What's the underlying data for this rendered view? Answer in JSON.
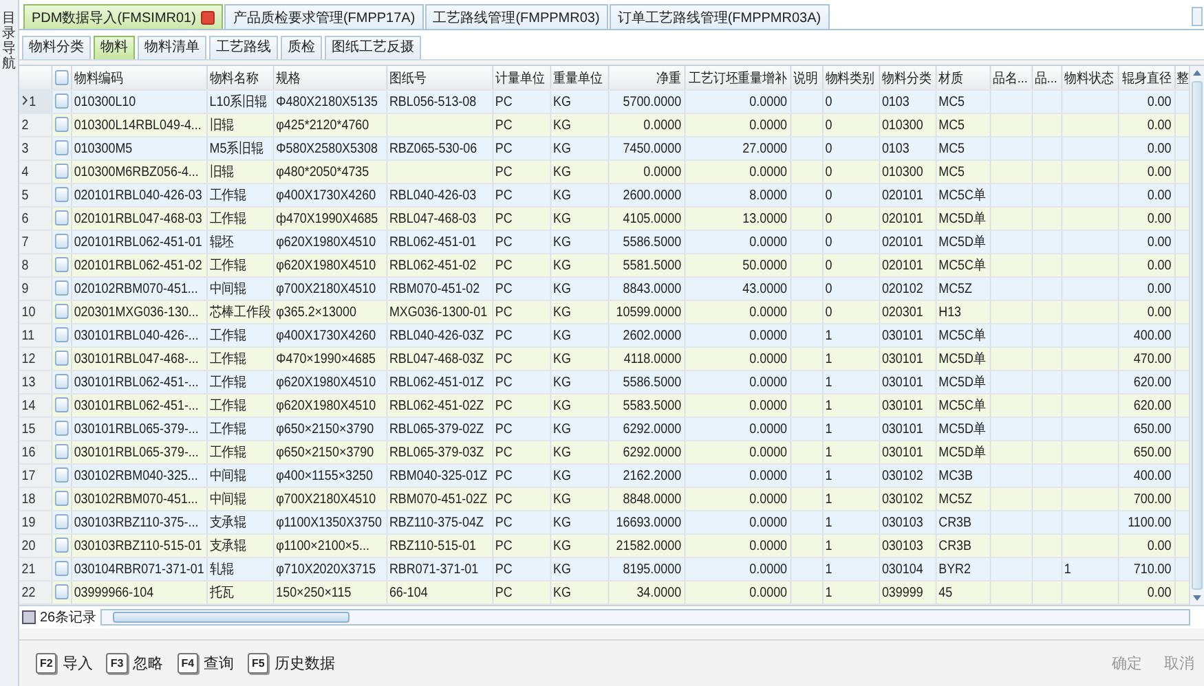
{
  "side_label": "目录导航",
  "tabs": [
    {
      "label": "PDM数据导入(FMSIMR01)",
      "selected": true,
      "closable": true
    },
    {
      "label": "产品质检要求管理(FMPP17A)",
      "selected": false,
      "closable": false
    },
    {
      "label": "工艺路线管理(FMPPMR03)",
      "selected": false,
      "closable": false
    },
    {
      "label": "订单工艺路线管理(FMPPMR03A)",
      "selected": false,
      "closable": false
    }
  ],
  "subtabs": [
    {
      "label": "物料分类",
      "selected": false
    },
    {
      "label": "物料",
      "selected": true
    },
    {
      "label": "物料清单",
      "selected": false
    },
    {
      "label": "工艺路线",
      "selected": false
    },
    {
      "label": "质检",
      "selected": false
    },
    {
      "label": "图纸工艺反摄",
      "selected": false
    }
  ],
  "table": {
    "columns": [
      {
        "label": "物料编码",
        "numeric": false
      },
      {
        "label": "物料名称",
        "numeric": false
      },
      {
        "label": "规格",
        "numeric": false
      },
      {
        "label": "图纸号",
        "numeric": false
      },
      {
        "label": "计量单位",
        "numeric": false
      },
      {
        "label": "重量单位",
        "numeric": false
      },
      {
        "label": "净重",
        "numeric": true
      },
      {
        "label": "工艺订坯重量增补",
        "numeric": true
      },
      {
        "label": "说明",
        "numeric": false
      },
      {
        "label": "物料类别",
        "numeric": false
      },
      {
        "label": "物料分类",
        "numeric": false
      },
      {
        "label": "材质",
        "numeric": false
      },
      {
        "label": "品名...",
        "numeric": false
      },
      {
        "label": "品...",
        "numeric": false
      },
      {
        "label": "物料状态",
        "numeric": false
      },
      {
        "label": "辊身直径",
        "numeric": true
      },
      {
        "label": "整",
        "numeric": false
      }
    ],
    "rows": [
      {
        "num": "1",
        "selected": true,
        "checked": false,
        "cells": [
          "010300L10",
          "L10系旧辊",
          "Φ480X2180X5135",
          "RBL056-513-08",
          "PC",
          "KG",
          "5700.0000",
          "0.0000",
          "",
          "0",
          "0103",
          "MC5",
          "",
          "",
          "",
          "0.00",
          ""
        ]
      },
      {
        "num": "2",
        "selected": false,
        "checked": false,
        "cells": [
          "010300L14RBL049-4...",
          "旧辊",
          "φ425*2120*4760",
          "",
          "PC",
          "KG",
          "0.0000",
          "0.0000",
          "",
          "0",
          "010300",
          "MC5",
          "",
          "",
          "",
          "0.00",
          ""
        ]
      },
      {
        "num": "3",
        "selected": false,
        "checked": false,
        "cells": [
          "010300M5",
          "M5系旧辊",
          "Φ580X2580X5308",
          "RBZ065-530-06",
          "PC",
          "KG",
          "7450.0000",
          "27.0000",
          "",
          "0",
          "0103",
          "MC5",
          "",
          "",
          "",
          "0.00",
          ""
        ]
      },
      {
        "num": "4",
        "selected": false,
        "checked": false,
        "cells": [
          "010300M6RBZ056-4...",
          "旧辊",
          "φ480*2050*4735",
          "",
          "PC",
          "KG",
          "0.0000",
          "0.0000",
          "",
          "0",
          "010300",
          "MC5",
          "",
          "",
          "",
          "0.00",
          ""
        ]
      },
      {
        "num": "5",
        "selected": false,
        "checked": false,
        "cells": [
          "020101RBL040-426-03",
          "工作辊",
          "φ400X1730X4260",
          "RBL040-426-03",
          "PC",
          "KG",
          "2600.0000",
          "8.0000",
          "",
          "0",
          "020101",
          "MC5C单",
          "",
          "",
          "",
          "0.00",
          ""
        ]
      },
      {
        "num": "6",
        "selected": false,
        "checked": false,
        "cells": [
          "020101RBL047-468-03",
          "工作辊",
          "ф470X1990X4685",
          "RBL047-468-03",
          "PC",
          "KG",
          "4105.0000",
          "13.0000",
          "",
          "0",
          "020101",
          "MC5D单",
          "",
          "",
          "",
          "0.00",
          ""
        ]
      },
      {
        "num": "7",
        "selected": false,
        "checked": false,
        "cells": [
          "020101RBL062-451-01",
          "辊坯",
          "φ620X1980X4510",
          "RBL062-451-01",
          "PC",
          "KG",
          "5586.5000",
          "0.0000",
          "",
          "0",
          "020101",
          "MC5D单",
          "",
          "",
          "",
          "0.00",
          ""
        ]
      },
      {
        "num": "8",
        "selected": false,
        "checked": false,
        "cells": [
          "020101RBL062-451-02",
          "工作辊",
          "φ620X1980X4510",
          "RBL062-451-02",
          "PC",
          "KG",
          "5581.5000",
          "50.0000",
          "",
          "0",
          "020101",
          "MC5C单",
          "",
          "",
          "",
          "0.00",
          ""
        ]
      },
      {
        "num": "9",
        "selected": false,
        "checked": false,
        "cells": [
          "020102RBM070-451...",
          "中间辊",
          "φ700X2180X4510",
          "RBM070-451-02",
          "PC",
          "KG",
          "8843.0000",
          "43.0000",
          "",
          "0",
          "020102",
          "MC5Z",
          "",
          "",
          "",
          "0.00",
          ""
        ]
      },
      {
        "num": "10",
        "selected": false,
        "checked": false,
        "cells": [
          "020301MXG036-130...",
          "芯棒工作段",
          "φ365.2×13000",
          "MXG036-1300-01",
          "PC",
          "KG",
          "10599.0000",
          "0.0000",
          "",
          "0",
          "020301",
          "H13",
          "",
          "",
          "",
          "0.00",
          ""
        ]
      },
      {
        "num": "11",
        "selected": false,
        "checked": false,
        "cells": [
          "030101RBL040-426-...",
          "工作辊",
          "φ400X1730X4260",
          "RBL040-426-03Z",
          "PC",
          "KG",
          "2602.0000",
          "0.0000",
          "",
          "1",
          "030101",
          "MC5C单",
          "",
          "",
          "",
          "400.00",
          ""
        ]
      },
      {
        "num": "12",
        "selected": false,
        "checked": false,
        "cells": [
          "030101RBL047-468-...",
          "工作辊",
          "Φ470×1990×4685",
          "RBL047-468-03Z",
          "PC",
          "KG",
          "4118.0000",
          "0.0000",
          "",
          "1",
          "030101",
          "MC5D单",
          "",
          "",
          "",
          "470.00",
          ""
        ]
      },
      {
        "num": "13",
        "selected": false,
        "checked": false,
        "cells": [
          "030101RBL062-451-...",
          "工作辊",
          "φ620X1980X4510",
          "RBL062-451-01Z",
          "PC",
          "KG",
          "5586.5000",
          "0.0000",
          "",
          "1",
          "030101",
          "MC5D单",
          "",
          "",
          "",
          "620.00",
          ""
        ]
      },
      {
        "num": "14",
        "selected": false,
        "checked": false,
        "cells": [
          "030101RBL062-451-...",
          "工作辊",
          "φ620X1980X4510",
          "RBL062-451-02Z",
          "PC",
          "KG",
          "5583.5000",
          "0.0000",
          "",
          "1",
          "030101",
          "MC5C单",
          "",
          "",
          "",
          "620.00",
          ""
        ]
      },
      {
        "num": "15",
        "selected": false,
        "checked": false,
        "cells": [
          "030101RBL065-379-...",
          "工作辊",
          "φ650×2150×3790",
          "RBL065-379-02Z",
          "PC",
          "KG",
          "6292.0000",
          "0.0000",
          "",
          "1",
          "030101",
          "MC5D单",
          "",
          "",
          "",
          "650.00",
          ""
        ]
      },
      {
        "num": "16",
        "selected": false,
        "checked": false,
        "cells": [
          "030101RBL065-379-...",
          "工作辊",
          "φ650×2150×3790",
          "RBL065-379-03Z",
          "PC",
          "KG",
          "6292.0000",
          "0.0000",
          "",
          "1",
          "030101",
          "MC5D单",
          "",
          "",
          "",
          "650.00",
          ""
        ]
      },
      {
        "num": "17",
        "selected": false,
        "checked": false,
        "cells": [
          "030102RBM040-325...",
          "中间辊",
          "φ400×1155×3250",
          "RBM040-325-01Z",
          "PC",
          "KG",
          "2162.2000",
          "0.0000",
          "",
          "1",
          "030102",
          "MC3B",
          "",
          "",
          "",
          "400.00",
          ""
        ]
      },
      {
        "num": "18",
        "selected": false,
        "checked": false,
        "cells": [
          "030102RBM070-451...",
          "中间辊",
          "φ700X2180X4510",
          "RBM070-451-02Z",
          "PC",
          "KG",
          "8848.0000",
          "0.0000",
          "",
          "1",
          "030102",
          "MC5Z",
          "",
          "",
          "",
          "700.00",
          ""
        ]
      },
      {
        "num": "19",
        "selected": false,
        "checked": false,
        "cells": [
          "030103RBZ110-375-...",
          "支承辊",
          "φ1100X1350X3750",
          "RBZ110-375-04Z",
          "PC",
          "KG",
          "16693.0000",
          "0.0000",
          "",
          "1",
          "030103",
          "CR3B",
          "",
          "",
          "",
          "1100.00",
          ""
        ]
      },
      {
        "num": "20",
        "selected": false,
        "checked": false,
        "cells": [
          "030103RBZ110-515-01",
          "支承辊",
          "φ1100×2100×5...",
          "RBZ110-515-01",
          "PC",
          "KG",
          "21582.0000",
          "0.0000",
          "",
          "1",
          "030103",
          "CR3B",
          "",
          "",
          "",
          "0.00",
          ""
        ]
      },
      {
        "num": "21",
        "selected": false,
        "checked": false,
        "cells": [
          "030104RBR071-371-01",
          "轧辊",
          "φ710X2020X3715",
          "RBR071-371-01",
          "PC",
          "KG",
          "8195.0000",
          "0.0000",
          "",
          "1",
          "030104",
          "BYR2",
          "",
          "",
          "1",
          "710.00",
          ""
        ]
      },
      {
        "num": "22",
        "selected": false,
        "checked": false,
        "cells": [
          "03999966-104",
          "托瓦",
          "150×250×115",
          "66-104",
          "PC",
          "KG",
          "34.0000",
          "0.0000",
          "",
          "1",
          "039999",
          "45",
          "",
          "",
          "",
          "0.00",
          ""
        ]
      }
    ],
    "record_count": "26条记录",
    "select_all_checked": false
  },
  "actions": [
    {
      "key": "F2",
      "label": "导入"
    },
    {
      "key": "F3",
      "label": "忽略"
    },
    {
      "key": "F4",
      "label": "查询"
    },
    {
      "key": "F5",
      "label": "历史数据"
    }
  ],
  "dialog_buttons": [
    {
      "label": "确定",
      "disabled": true
    },
    {
      "label": "取消",
      "disabled": true
    }
  ]
}
